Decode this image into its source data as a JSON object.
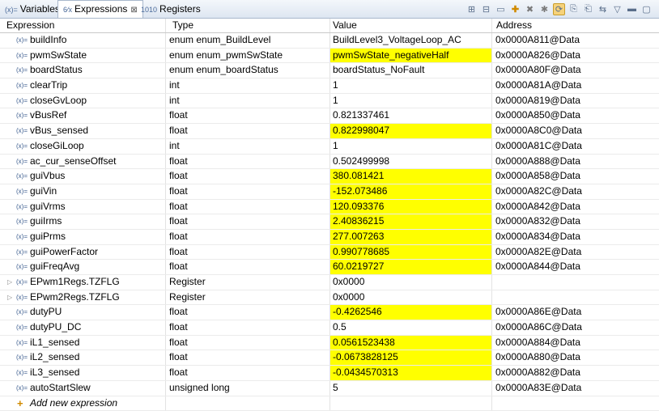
{
  "tabs": [
    {
      "icon": "(x)=",
      "label": "Variables",
      "active": false
    },
    {
      "icon": "6⁄x",
      "label": "Expressions",
      "close": "⊠",
      "active": true
    },
    {
      "icon": "1010",
      "label": "Registers",
      "active": false
    }
  ],
  "toolbar": [
    "show-type-names-icon",
    "collapse-all-icon",
    "remove-all-icon",
    "add-expression-icon",
    "remove-expression-icon",
    "refresh-icon",
    "continuous-refresh-icon",
    "export-icon",
    "import-icon",
    "link-icon",
    "view-menu-icon",
    "minimize-icon",
    "maximize-icon"
  ],
  "columns": {
    "expression": "Expression",
    "type": "Type",
    "value": "Value",
    "address": "Address"
  },
  "rows": [
    {
      "name": "buildInfo",
      "type": "enum enum_BuildLevel",
      "value": "BuildLevel3_VoltageLoop_AC",
      "address": "0x0000A811@Data",
      "changed": false
    },
    {
      "name": "pwmSwState",
      "type": "enum enum_pwmSwState",
      "value": "pwmSwState_negativeHalf",
      "address": "0x0000A826@Data",
      "changed": true
    },
    {
      "name": "boardStatus",
      "type": "enum enum_boardStatus",
      "value": "boardStatus_NoFault",
      "address": "0x0000A80F@Data",
      "changed": false
    },
    {
      "name": "clearTrip",
      "type": "int",
      "value": "1",
      "address": "0x0000A81A@Data",
      "changed": false
    },
    {
      "name": "closeGvLoop",
      "type": "int",
      "value": "1",
      "address": "0x0000A819@Data",
      "changed": false
    },
    {
      "name": "vBusRef",
      "type": "float",
      "value": "0.821337461",
      "address": "0x0000A850@Data",
      "changed": false
    },
    {
      "name": "vBus_sensed",
      "type": "float",
      "value": "0.822998047",
      "address": "0x0000A8C0@Data",
      "changed": true
    },
    {
      "name": "closeGiLoop",
      "type": "int",
      "value": "1",
      "address": "0x0000A81C@Data",
      "changed": false
    },
    {
      "name": "ac_cur_senseOffset",
      "type": "float",
      "value": "0.502499998",
      "address": "0x0000A888@Data",
      "changed": false
    },
    {
      "name": "guiVbus",
      "type": "float",
      "value": "380.081421",
      "address": "0x0000A858@Data",
      "changed": true
    },
    {
      "name": "guiVin",
      "type": "float",
      "value": "-152.073486",
      "address": "0x0000A82C@Data",
      "changed": true
    },
    {
      "name": "guiVrms",
      "type": "float",
      "value": "120.093376",
      "address": "0x0000A842@Data",
      "changed": true
    },
    {
      "name": "guiIrms",
      "type": "float",
      "value": "2.40836215",
      "address": "0x0000A832@Data",
      "changed": true
    },
    {
      "name": "guiPrms",
      "type": "float",
      "value": "277.007263",
      "address": "0x0000A834@Data",
      "changed": true
    },
    {
      "name": "guiPowerFactor",
      "type": "float",
      "value": "0.990778685",
      "address": "0x0000A82E@Data",
      "changed": true
    },
    {
      "name": "guiFreqAvg",
      "type": "float",
      "value": "60.0219727",
      "address": "0x0000A844@Data",
      "changed": true
    },
    {
      "name": "EPwm1Regs.TZFLG",
      "type": "Register",
      "value": "0x0000",
      "address": "",
      "changed": false,
      "expandable": true
    },
    {
      "name": "EPwm2Regs.TZFLG",
      "type": "Register",
      "value": "0x0000",
      "address": "",
      "changed": false,
      "expandable": true
    },
    {
      "name": "dutyPU",
      "type": "float",
      "value": "-0.4262546",
      "address": "0x0000A86E@Data",
      "changed": true
    },
    {
      "name": "dutyPU_DC",
      "type": "float",
      "value": "0.5",
      "address": "0x0000A86C@Data",
      "changed": false
    },
    {
      "name": "iL1_sensed",
      "type": "float",
      "value": "0.0561523438",
      "address": "0x0000A884@Data",
      "changed": true
    },
    {
      "name": "iL2_sensed",
      "type": "float",
      "value": "-0.0673828125",
      "address": "0x0000A880@Data",
      "changed": true
    },
    {
      "name": "iL3_sensed",
      "type": "float",
      "value": "-0.0434570313",
      "address": "0x0000A882@Data",
      "changed": true
    },
    {
      "name": "autoStartSlew",
      "type": "unsigned long",
      "value": "5",
      "address": "0x0000A83E@Data",
      "changed": false
    }
  ],
  "add_row": {
    "label": "Add new expression"
  },
  "colors": {
    "changed_value": "#ffff00",
    "variable_icon": "#3c5d8f",
    "add_icon": "#d08a00"
  }
}
